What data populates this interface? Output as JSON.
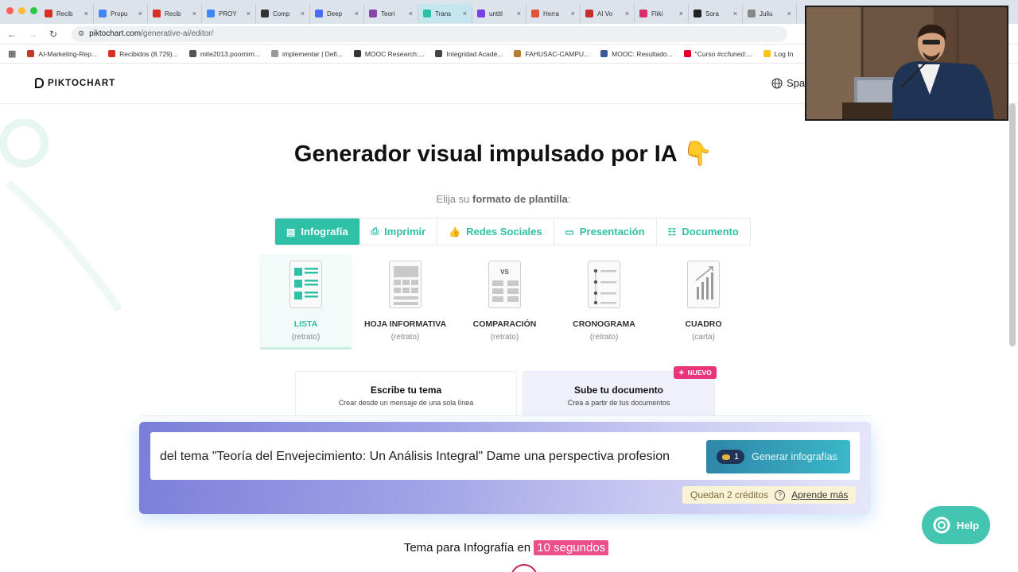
{
  "browser": {
    "tabs": [
      {
        "label": "Recib",
        "color": "#d93025"
      },
      {
        "label": "Propu",
        "color": "#4285f4"
      },
      {
        "label": "Recib",
        "color": "#d93025"
      },
      {
        "label": "PROY",
        "color": "#4285f4"
      },
      {
        "label": "Comp",
        "color": "#333333"
      },
      {
        "label": "Deep",
        "color": "#4d6bfe"
      },
      {
        "label": "Teori",
        "color": "#8e44ad"
      },
      {
        "label": "Trans",
        "color": "#2fc0a8",
        "active": true
      },
      {
        "label": "untitl",
        "color": "#7b3fe4"
      },
      {
        "label": "Herra",
        "color": "#e0533a"
      },
      {
        "label": "AI Vo",
        "color": "#c4302b"
      },
      {
        "label": "Fliki",
        "color": "#d6336c"
      },
      {
        "label": "Sora",
        "color": "#222222"
      },
      {
        "label": "Juliu",
        "color": "#888888"
      }
    ],
    "url_host": "piktochart.com",
    "url_path": "/generative-ai/editor/",
    "bookmarks": [
      {
        "label": "AI-Marketing-Rep...",
        "color": "#c0392b"
      },
      {
        "label": "Recibidos (8.729)...",
        "color": "#d93025"
      },
      {
        "label": "mite2013.poornim...",
        "color": "#555555"
      },
      {
        "label": "implementar | Defi...",
        "color": "#999999"
      },
      {
        "label": "MOOC Research:...",
        "color": "#333333"
      },
      {
        "label": "Integridad Acadé...",
        "color": "#444444"
      },
      {
        "label": "FAHUSAC-CAMPU...",
        "color": "#b57b2e"
      },
      {
        "label": "MOOC: Resultado...",
        "color": "#3d5a98"
      },
      {
        "label": "\"Curso #ccfuned:...",
        "color": "#e60023"
      },
      {
        "label": "Log In",
        "color": "#f5c518"
      }
    ]
  },
  "header": {
    "logo_text": "PIKTOCHART",
    "language": "Spa"
  },
  "hero": {
    "title": "Generador visual impulsado por IA",
    "emoji": "👇",
    "subtitle_prefix": "Elija su",
    "subtitle_bold": "formato de plantilla",
    "subtitle_suffix": ":"
  },
  "format_tabs": [
    {
      "label": "Infografía",
      "icon": "chart-icon",
      "active": true
    },
    {
      "label": "Imprimir",
      "icon": "print-icon"
    },
    {
      "label": "Redes Sociales",
      "icon": "thumbs-up-icon"
    },
    {
      "label": "Presentación",
      "icon": "presentation-icon"
    },
    {
      "label": "Documento",
      "icon": "document-icon"
    }
  ],
  "templates": [
    {
      "name": "LISTA",
      "sub": "(retrato)",
      "active": true
    },
    {
      "name": "HOJA INFORMATIVA",
      "sub": "(retrato)"
    },
    {
      "name": "COMPARACIÓN",
      "sub": "(retrato)",
      "thumb_text": "VS"
    },
    {
      "name": "CRONOGRAMA",
      "sub": "(retrato)"
    },
    {
      "name": "CUADRO",
      "sub": "(carta)"
    }
  ],
  "input_modes": {
    "write": {
      "title": "Escribe tu tema",
      "desc": "Crear desde un mensaje de una sola línea"
    },
    "upload": {
      "title": "Sube tu documento",
      "desc": "Crea a partir de tus documentos"
    },
    "new_badge": "NUEVO"
  },
  "prompt": {
    "text": "del tema \"Teoría del Envejecimiento: Un Análisis Integral\" Dame una perspectiva profesion",
    "generate_label": "Generar infografías",
    "cost": "1",
    "credits_text": "Quedan 2 créditos",
    "learn_more": "Aprende más"
  },
  "tagline": {
    "prefix": "Tema para Infografía en",
    "highlight": "10 segundos"
  },
  "help": {
    "label": "Help"
  },
  "colors": {
    "accent": "#2fc0a8",
    "pink": "#e8357a"
  }
}
